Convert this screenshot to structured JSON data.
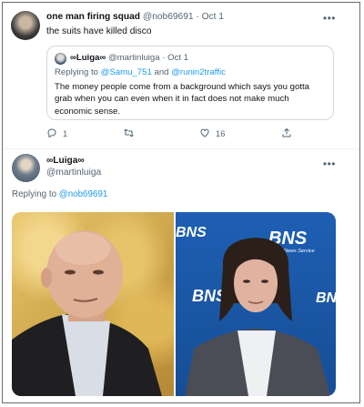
{
  "tweet1": {
    "name": "one man firing squad",
    "handle": "@nob69691",
    "separator": "·",
    "date": "Oct 1",
    "text": "the suits have killed disco",
    "more_icon": "more-horizontal-icon",
    "quote": {
      "name": "∞Luiga∞",
      "handle": "@martinluiga",
      "separator": "·",
      "date": "Oct 1",
      "replying_prefix": "Replying to",
      "reply_user1": "@Samu_751",
      "reply_and": "and",
      "reply_user2": "@runin2traffic",
      "text": "The money people come from a background which says you gotta grab when you can even when it in fact does not make much economic sense."
    },
    "actions": {
      "reply_count": "1",
      "retweet_count": "",
      "like_count": "16",
      "share_count": ""
    }
  },
  "tweet2": {
    "name": "∞Luiga∞",
    "handle": "@martinluiga",
    "replying_prefix": "Replying to",
    "reply_user": "@nob69691",
    "photo_right_logo": "BNS",
    "photo_right_sub": "Baltic News Service"
  },
  "colors": {
    "link": "#1d9bf0",
    "muted": "#536471",
    "border": "#cfd9de",
    "bns_blue": "#1e5fb3"
  }
}
